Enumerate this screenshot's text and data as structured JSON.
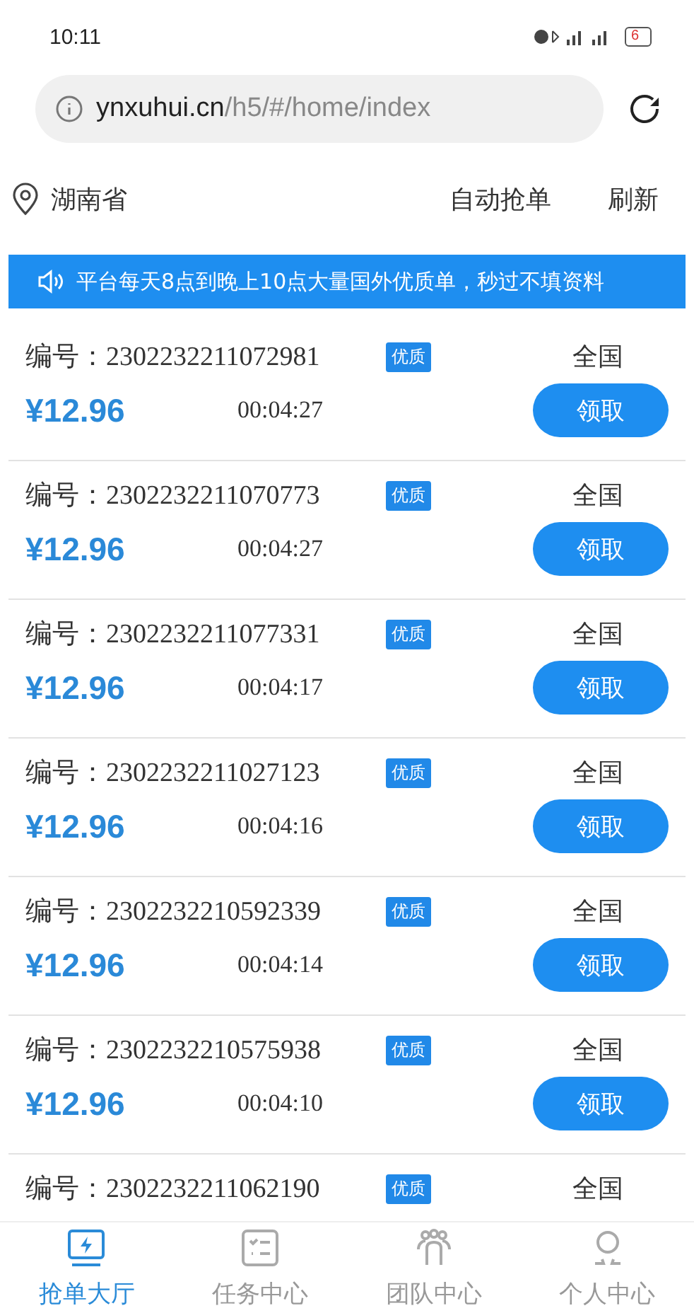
{
  "status_bar": {
    "time": "10:11",
    "battery": "6"
  },
  "address_bar": {
    "domain": "ynxuhui.cn",
    "path": "/h5/#/home/index"
  },
  "header": {
    "location": "湖南省",
    "actions": [
      "自动抢单",
      "刷新"
    ]
  },
  "notice": "平台每天8点到晚上10点大量国外优质单，秒过不填资料",
  "orders": [
    {
      "id_label": "编号：",
      "id": "2302232211072981",
      "badge": "优质",
      "region": "全国",
      "price": "¥12.96",
      "time": "00:04:27",
      "button": "领取"
    },
    {
      "id_label": "编号：",
      "id": "2302232211070773",
      "badge": "优质",
      "region": "全国",
      "price": "¥12.96",
      "time": "00:04:27",
      "button": "领取"
    },
    {
      "id_label": "编号：",
      "id": "2302232211077331",
      "badge": "优质",
      "region": "全国",
      "price": "¥12.96",
      "time": "00:04:17",
      "button": "领取"
    },
    {
      "id_label": "编号：",
      "id": "2302232211027123",
      "badge": "优质",
      "region": "全国",
      "price": "¥12.96",
      "time": "00:04:16",
      "button": "领取"
    },
    {
      "id_label": "编号：",
      "id": "2302232210592339",
      "badge": "优质",
      "region": "全国",
      "price": "¥12.96",
      "time": "00:04:14",
      "button": "领取"
    },
    {
      "id_label": "编号：",
      "id": "2302232210575938",
      "badge": "优质",
      "region": "全国",
      "price": "¥12.96",
      "time": "00:04:10",
      "button": "领取"
    },
    {
      "id_label": "编号：",
      "id": "2302232211062190",
      "badge": "优质",
      "region": "全国"
    }
  ],
  "tabs": [
    {
      "label": "抢单大厅",
      "selected": true,
      "kind": "monitor"
    },
    {
      "label": "任务中心",
      "selected": false,
      "kind": "checklist"
    },
    {
      "label": "团队中心",
      "selected": false,
      "kind": "team"
    },
    {
      "label": "个人中心",
      "selected": false,
      "kind": "person"
    }
  ]
}
